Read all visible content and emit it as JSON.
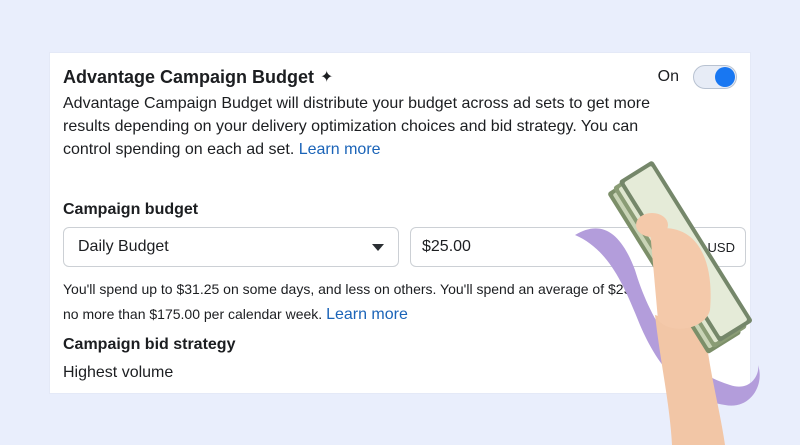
{
  "header": {
    "title": "Advantage Campaign Budget",
    "toggle_label": "On",
    "toggle_on": true,
    "description_main": "Advantage Campaign Budget will distribute your budget across ad sets to get more results depending on your delivery optimization choices and bid strategy. You can control spending on each ad set.",
    "learn_more": "Learn more"
  },
  "budget": {
    "section_label": "Campaign budget",
    "type_value": "Daily Budget",
    "amount_value": "$25.00",
    "currency": "USD",
    "note_line1": "You'll spend up to $31.25 on some days, and less on others. You'll spend an average of $25.",
    "note_line2": "no more than $175.00 per calendar week.",
    "learn_more": "Learn more"
  },
  "bid": {
    "section_label": "Campaign bid strategy",
    "value": "Highest volume"
  },
  "colors": {
    "accent": "#1877f2",
    "link": "#1b64b8",
    "background": "#e9eefc"
  }
}
